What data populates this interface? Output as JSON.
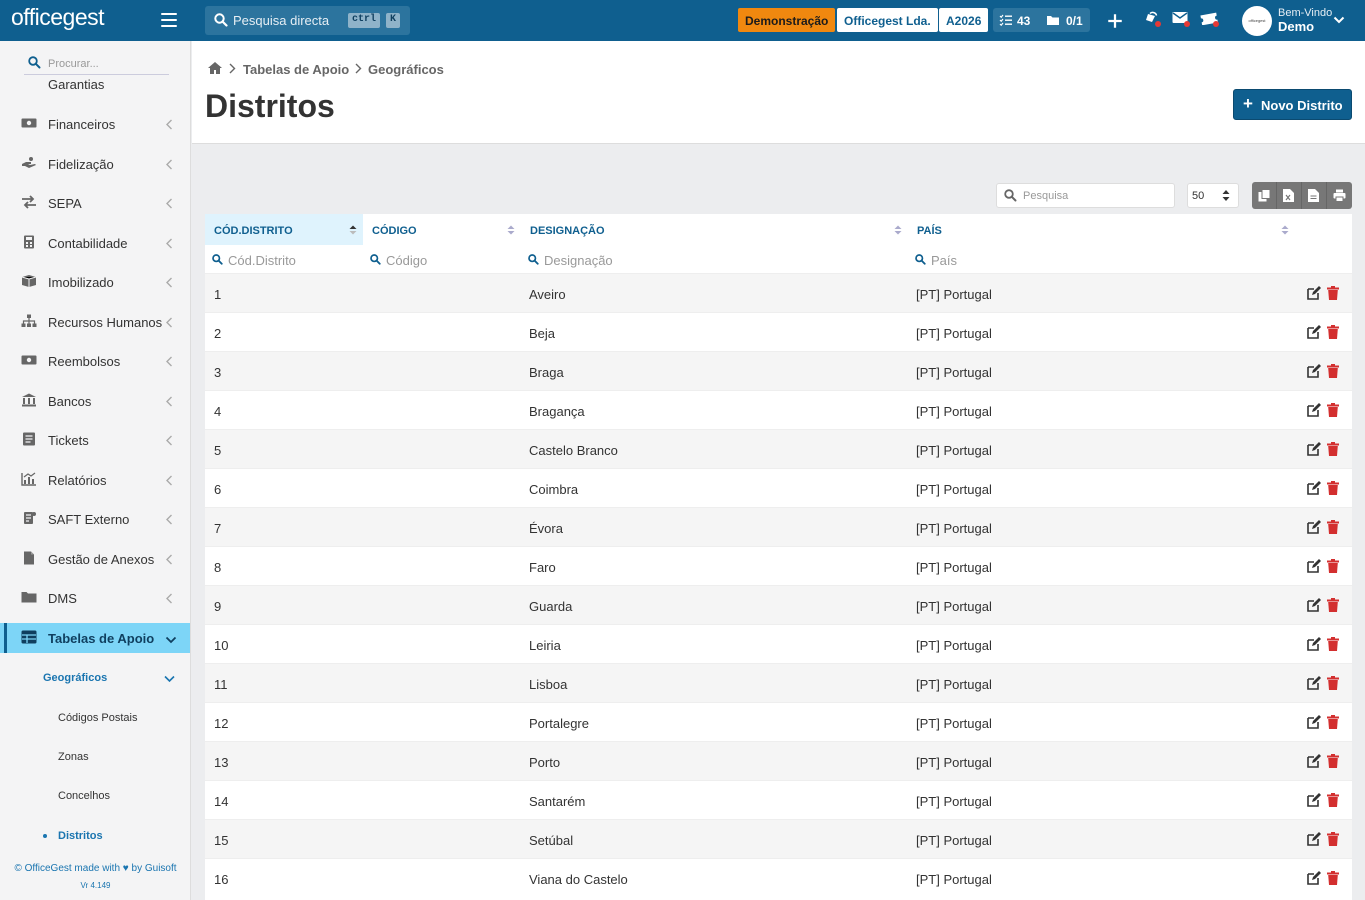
{
  "topbar": {
    "logo": "officegest",
    "search_label": "Pesquisa directa",
    "shortcut_key1": "ctrl",
    "shortcut_key2": "K",
    "demo_badge": "Demonstração",
    "company_badge": "Officegest Lda.",
    "year_badge": "A2026",
    "tasks_count": "43",
    "docs_count": "0/1",
    "welcome": "Bem-Vindo",
    "username": "Demo",
    "avatar_text": "officegest"
  },
  "sidebar": {
    "search_placeholder": "Procurar...",
    "partial_item": "Garantias",
    "items": [
      {
        "label": "Financeiros",
        "icon": "money-icon"
      },
      {
        "label": "Fidelização",
        "icon": "hand-icon"
      },
      {
        "label": "SEPA",
        "icon": "exchange-icon"
      },
      {
        "label": "Contabilidade",
        "icon": "calculator-icon"
      },
      {
        "label": "Imobilizado",
        "icon": "box-icon"
      },
      {
        "label": "Recursos Humanos",
        "icon": "sitemap-icon"
      },
      {
        "label": "Reembolsos",
        "icon": "money-icon"
      },
      {
        "label": "Bancos",
        "icon": "bank-icon"
      },
      {
        "label": "Tickets",
        "icon": "ticket-icon"
      },
      {
        "label": "Relatórios",
        "icon": "chart-icon"
      },
      {
        "label": "SAFT Externo",
        "icon": "saft-icon"
      },
      {
        "label": "Gestão de Anexos",
        "icon": "file-icon"
      },
      {
        "label": "DMS",
        "icon": "folder-icon"
      },
      {
        "label": "Tabelas de Apoio",
        "icon": "table-icon"
      }
    ],
    "sub_head": "Geográficos",
    "sub_items": [
      "Códigos Postais",
      "Zonas",
      "Concelhos",
      "Distritos"
    ],
    "footer_prefix": "© OfficeGest made with",
    "footer_suffix": "by Guisoft",
    "version": "Vr 4.149"
  },
  "breadcrumb": [
    "Tabelas de Apoio",
    "Geográficos"
  ],
  "page_title": "Distritos",
  "new_button": "Novo Distrito",
  "table_tools": {
    "search_placeholder": "Pesquisa",
    "page_size": "50"
  },
  "columns": [
    {
      "label": "CÓD.DISTRITO",
      "filter": "Cód.Distrito"
    },
    {
      "label": "CÓDIGO",
      "filter": "Código"
    },
    {
      "label": "DESIGNAÇÃO",
      "filter": "Designação"
    },
    {
      "label": "PAÍS",
      "filter": "País"
    }
  ],
  "rows": [
    {
      "id": "1",
      "codigo": "",
      "designacao": "Aveiro",
      "pais": "[PT] Portugal"
    },
    {
      "id": "2",
      "codigo": "",
      "designacao": "Beja",
      "pais": "[PT] Portugal"
    },
    {
      "id": "3",
      "codigo": "",
      "designacao": "Braga",
      "pais": "[PT] Portugal"
    },
    {
      "id": "4",
      "codigo": "",
      "designacao": "Bragança",
      "pais": "[PT] Portugal"
    },
    {
      "id": "5",
      "codigo": "",
      "designacao": "Castelo Branco",
      "pais": "[PT] Portugal"
    },
    {
      "id": "6",
      "codigo": "",
      "designacao": "Coimbra",
      "pais": "[PT] Portugal"
    },
    {
      "id": "7",
      "codigo": "",
      "designacao": "Évora",
      "pais": "[PT] Portugal"
    },
    {
      "id": "8",
      "codigo": "",
      "designacao": "Faro",
      "pais": "[PT] Portugal"
    },
    {
      "id": "9",
      "codigo": "",
      "designacao": "Guarda",
      "pais": "[PT] Portugal"
    },
    {
      "id": "10",
      "codigo": "",
      "designacao": "Leiria",
      "pais": "[PT] Portugal"
    },
    {
      "id": "11",
      "codigo": "",
      "designacao": "Lisboa",
      "pais": "[PT] Portugal"
    },
    {
      "id": "12",
      "codigo": "",
      "designacao": "Portalegre",
      "pais": "[PT] Portugal"
    },
    {
      "id": "13",
      "codigo": "",
      "designacao": "Porto",
      "pais": "[PT] Portugal"
    },
    {
      "id": "14",
      "codigo": "",
      "designacao": "Santarém",
      "pais": "[PT] Portugal"
    },
    {
      "id": "15",
      "codigo": "",
      "designacao": "Setúbal",
      "pais": "[PT] Portugal"
    },
    {
      "id": "16",
      "codigo": "",
      "designacao": "Viana do Castelo",
      "pais": "[PT] Portugal"
    }
  ],
  "colors": {
    "brand": "#0f5f8f",
    "accent": "#7dd5f7",
    "demo": "#f0880f",
    "delete": "#d32f2f",
    "link": "#1a75b0"
  }
}
